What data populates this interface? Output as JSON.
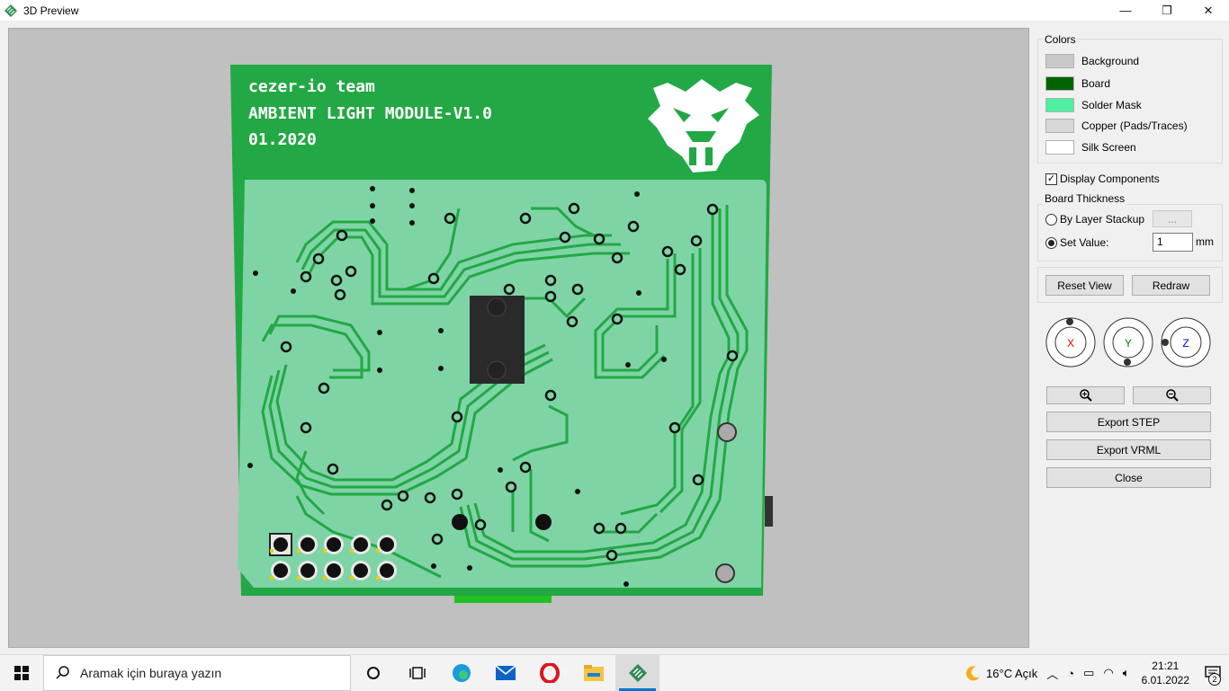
{
  "window": {
    "title": "3D Preview",
    "minimize": "—",
    "maximize": "❐",
    "close": "✕"
  },
  "board": {
    "silk_line1": "cezer-io team",
    "silk_line2": "AMBIENT LIGHT MODULE-V1.0",
    "silk_line3": "01.2020"
  },
  "colors": {
    "title": "Colors",
    "items": [
      {
        "label": "Background",
        "color": "#c8c8c8"
      },
      {
        "label": "Board",
        "color": "#006400"
      },
      {
        "label": "Solder Mask",
        "color": "#4cf0a0"
      },
      {
        "label": "Copper (Pads/Traces)",
        "color": "#d8d8d8"
      },
      {
        "label": "Silk Screen",
        "color": "#ffffff"
      }
    ]
  },
  "display_components": {
    "label": "Display Components",
    "checked": "✓"
  },
  "thickness": {
    "title": "Board Thickness",
    "by_layer_label": "By Layer Stackup",
    "by_layer_btn": "...",
    "set_value_label": "Set Value:",
    "value": "1",
    "unit": "mm"
  },
  "buttons": {
    "reset_view": "Reset View",
    "redraw": "Redraw",
    "export_step": "Export STEP",
    "export_vrml": "Export VRML",
    "close": "Close"
  },
  "axes": {
    "x": "X",
    "y": "Y",
    "z": "Z",
    "x_color": "#e00000",
    "y_color": "#008000",
    "z_color": "#0000e0"
  },
  "taskbar": {
    "search_placeholder": "Aramak için buraya yazın",
    "weather": "16°C  Açık",
    "time": "21:21",
    "date": "6.01.2022",
    "notification_count": "2"
  }
}
